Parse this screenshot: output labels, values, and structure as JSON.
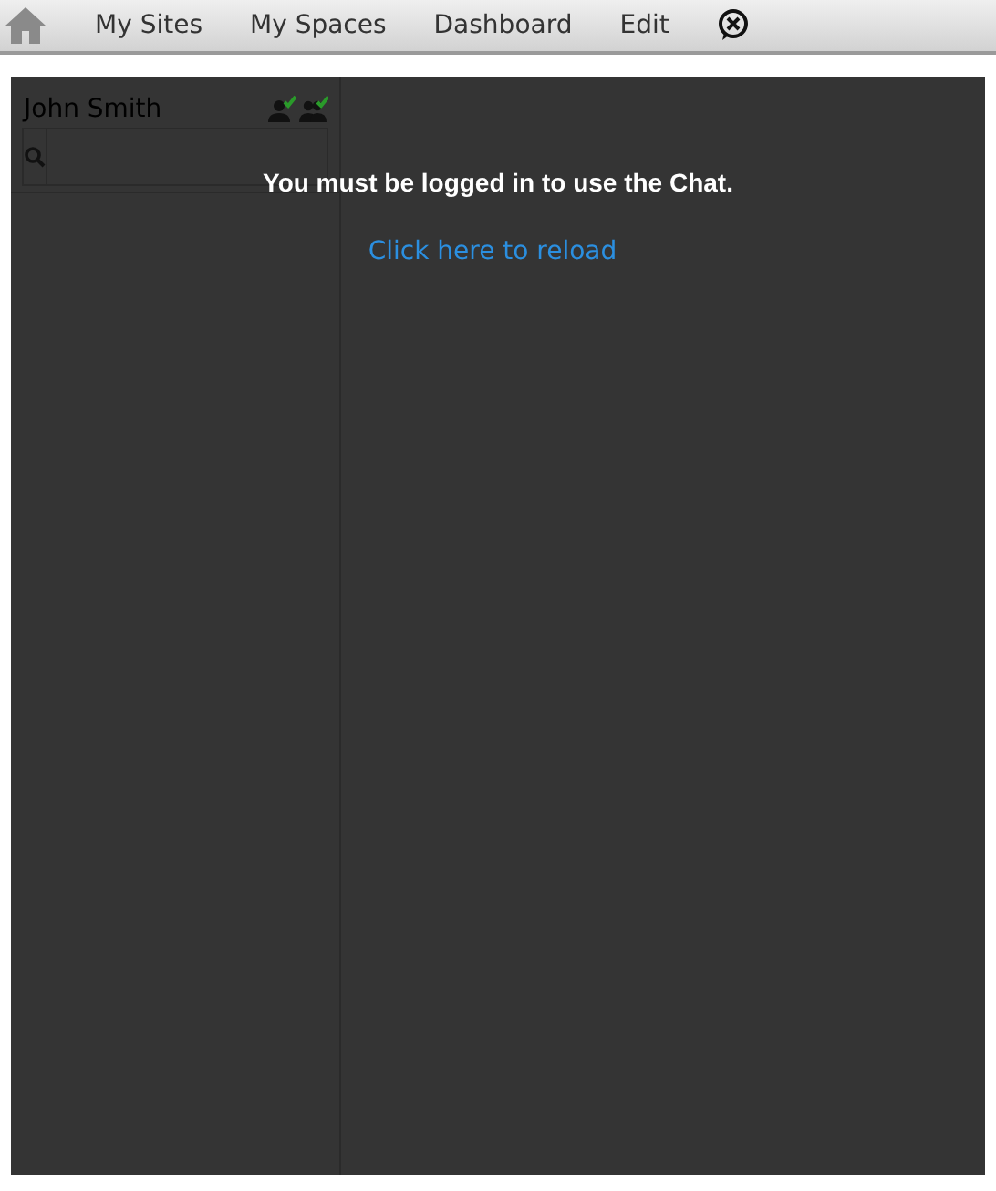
{
  "nav": {
    "items": [
      {
        "label": "My Sites"
      },
      {
        "label": "My Spaces"
      },
      {
        "label": "Dashboard"
      },
      {
        "label": "Edit"
      }
    ]
  },
  "chat": {
    "user_name": "John Smith",
    "message": "You must be logged in to use the Chat.",
    "reload_link": "Click here to reload"
  }
}
